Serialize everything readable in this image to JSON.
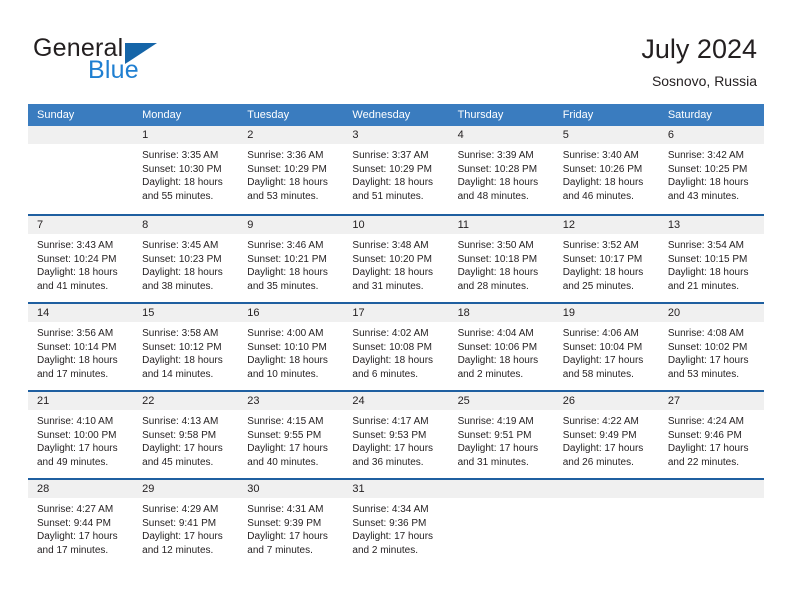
{
  "brand": {
    "name_part1": "General",
    "name_part2": "Blue"
  },
  "header": {
    "title": "July 2024",
    "location": "Sosnovo, Russia"
  },
  "colors": {
    "header_blue": "#3a7cbf",
    "row_divider_blue": "#1f5fa0",
    "daynum_band": "#f0f0f0",
    "brand_blue": "#1f7fd1",
    "brand_flag": "#1565a8",
    "text": "#231f20"
  },
  "weekdays": [
    "Sunday",
    "Monday",
    "Tuesday",
    "Wednesday",
    "Thursday",
    "Friday",
    "Saturday"
  ],
  "weeks": [
    [
      {
        "day": "",
        "sunrise": "",
        "sunset": "",
        "daylight_line1": "",
        "daylight_line2": ""
      },
      {
        "day": "1",
        "sunrise": "Sunrise: 3:35 AM",
        "sunset": "Sunset: 10:30 PM",
        "daylight_line1": "Daylight: 18 hours",
        "daylight_line2": "and 55 minutes."
      },
      {
        "day": "2",
        "sunrise": "Sunrise: 3:36 AM",
        "sunset": "Sunset: 10:29 PM",
        "daylight_line1": "Daylight: 18 hours",
        "daylight_line2": "and 53 minutes."
      },
      {
        "day": "3",
        "sunrise": "Sunrise: 3:37 AM",
        "sunset": "Sunset: 10:29 PM",
        "daylight_line1": "Daylight: 18 hours",
        "daylight_line2": "and 51 minutes."
      },
      {
        "day": "4",
        "sunrise": "Sunrise: 3:39 AM",
        "sunset": "Sunset: 10:28 PM",
        "daylight_line1": "Daylight: 18 hours",
        "daylight_line2": "and 48 minutes."
      },
      {
        "day": "5",
        "sunrise": "Sunrise: 3:40 AM",
        "sunset": "Sunset: 10:26 PM",
        "daylight_line1": "Daylight: 18 hours",
        "daylight_line2": "and 46 minutes."
      },
      {
        "day": "6",
        "sunrise": "Sunrise: 3:42 AM",
        "sunset": "Sunset: 10:25 PM",
        "daylight_line1": "Daylight: 18 hours",
        "daylight_line2": "and 43 minutes."
      }
    ],
    [
      {
        "day": "7",
        "sunrise": "Sunrise: 3:43 AM",
        "sunset": "Sunset: 10:24 PM",
        "daylight_line1": "Daylight: 18 hours",
        "daylight_line2": "and 41 minutes."
      },
      {
        "day": "8",
        "sunrise": "Sunrise: 3:45 AM",
        "sunset": "Sunset: 10:23 PM",
        "daylight_line1": "Daylight: 18 hours",
        "daylight_line2": "and 38 minutes."
      },
      {
        "day": "9",
        "sunrise": "Sunrise: 3:46 AM",
        "sunset": "Sunset: 10:21 PM",
        "daylight_line1": "Daylight: 18 hours",
        "daylight_line2": "and 35 minutes."
      },
      {
        "day": "10",
        "sunrise": "Sunrise: 3:48 AM",
        "sunset": "Sunset: 10:20 PM",
        "daylight_line1": "Daylight: 18 hours",
        "daylight_line2": "and 31 minutes."
      },
      {
        "day": "11",
        "sunrise": "Sunrise: 3:50 AM",
        "sunset": "Sunset: 10:18 PM",
        "daylight_line1": "Daylight: 18 hours",
        "daylight_line2": "and 28 minutes."
      },
      {
        "day": "12",
        "sunrise": "Sunrise: 3:52 AM",
        "sunset": "Sunset: 10:17 PM",
        "daylight_line1": "Daylight: 18 hours",
        "daylight_line2": "and 25 minutes."
      },
      {
        "day": "13",
        "sunrise": "Sunrise: 3:54 AM",
        "sunset": "Sunset: 10:15 PM",
        "daylight_line1": "Daylight: 18 hours",
        "daylight_line2": "and 21 minutes."
      }
    ],
    [
      {
        "day": "14",
        "sunrise": "Sunrise: 3:56 AM",
        "sunset": "Sunset: 10:14 PM",
        "daylight_line1": "Daylight: 18 hours",
        "daylight_line2": "and 17 minutes."
      },
      {
        "day": "15",
        "sunrise": "Sunrise: 3:58 AM",
        "sunset": "Sunset: 10:12 PM",
        "daylight_line1": "Daylight: 18 hours",
        "daylight_line2": "and 14 minutes."
      },
      {
        "day": "16",
        "sunrise": "Sunrise: 4:00 AM",
        "sunset": "Sunset: 10:10 PM",
        "daylight_line1": "Daylight: 18 hours",
        "daylight_line2": "and 10 minutes."
      },
      {
        "day": "17",
        "sunrise": "Sunrise: 4:02 AM",
        "sunset": "Sunset: 10:08 PM",
        "daylight_line1": "Daylight: 18 hours",
        "daylight_line2": "and 6 minutes."
      },
      {
        "day": "18",
        "sunrise": "Sunrise: 4:04 AM",
        "sunset": "Sunset: 10:06 PM",
        "daylight_line1": "Daylight: 18 hours",
        "daylight_line2": "and 2 minutes."
      },
      {
        "day": "19",
        "sunrise": "Sunrise: 4:06 AM",
        "sunset": "Sunset: 10:04 PM",
        "daylight_line1": "Daylight: 17 hours",
        "daylight_line2": "and 58 minutes."
      },
      {
        "day": "20",
        "sunrise": "Sunrise: 4:08 AM",
        "sunset": "Sunset: 10:02 PM",
        "daylight_line1": "Daylight: 17 hours",
        "daylight_line2": "and 53 minutes."
      }
    ],
    [
      {
        "day": "21",
        "sunrise": "Sunrise: 4:10 AM",
        "sunset": "Sunset: 10:00 PM",
        "daylight_line1": "Daylight: 17 hours",
        "daylight_line2": "and 49 minutes."
      },
      {
        "day": "22",
        "sunrise": "Sunrise: 4:13 AM",
        "sunset": "Sunset: 9:58 PM",
        "daylight_line1": "Daylight: 17 hours",
        "daylight_line2": "and 45 minutes."
      },
      {
        "day": "23",
        "sunrise": "Sunrise: 4:15 AM",
        "sunset": "Sunset: 9:55 PM",
        "daylight_line1": "Daylight: 17 hours",
        "daylight_line2": "and 40 minutes."
      },
      {
        "day": "24",
        "sunrise": "Sunrise: 4:17 AM",
        "sunset": "Sunset: 9:53 PM",
        "daylight_line1": "Daylight: 17 hours",
        "daylight_line2": "and 36 minutes."
      },
      {
        "day": "25",
        "sunrise": "Sunrise: 4:19 AM",
        "sunset": "Sunset: 9:51 PM",
        "daylight_line1": "Daylight: 17 hours",
        "daylight_line2": "and 31 minutes."
      },
      {
        "day": "26",
        "sunrise": "Sunrise: 4:22 AM",
        "sunset": "Sunset: 9:49 PM",
        "daylight_line1": "Daylight: 17 hours",
        "daylight_line2": "and 26 minutes."
      },
      {
        "day": "27",
        "sunrise": "Sunrise: 4:24 AM",
        "sunset": "Sunset: 9:46 PM",
        "daylight_line1": "Daylight: 17 hours",
        "daylight_line2": "and 22 minutes."
      }
    ],
    [
      {
        "day": "28",
        "sunrise": "Sunrise: 4:27 AM",
        "sunset": "Sunset: 9:44 PM",
        "daylight_line1": "Daylight: 17 hours",
        "daylight_line2": "and 17 minutes."
      },
      {
        "day": "29",
        "sunrise": "Sunrise: 4:29 AM",
        "sunset": "Sunset: 9:41 PM",
        "daylight_line1": "Daylight: 17 hours",
        "daylight_line2": "and 12 minutes."
      },
      {
        "day": "30",
        "sunrise": "Sunrise: 4:31 AM",
        "sunset": "Sunset: 9:39 PM",
        "daylight_line1": "Daylight: 17 hours",
        "daylight_line2": "and 7 minutes."
      },
      {
        "day": "31",
        "sunrise": "Sunrise: 4:34 AM",
        "sunset": "Sunset: 9:36 PM",
        "daylight_line1": "Daylight: 17 hours",
        "daylight_line2": "and 2 minutes."
      },
      {
        "day": "",
        "sunrise": "",
        "sunset": "",
        "daylight_line1": "",
        "daylight_line2": ""
      },
      {
        "day": "",
        "sunrise": "",
        "sunset": "",
        "daylight_line1": "",
        "daylight_line2": ""
      },
      {
        "day": "",
        "sunrise": "",
        "sunset": "",
        "daylight_line1": "",
        "daylight_line2": ""
      }
    ]
  ]
}
